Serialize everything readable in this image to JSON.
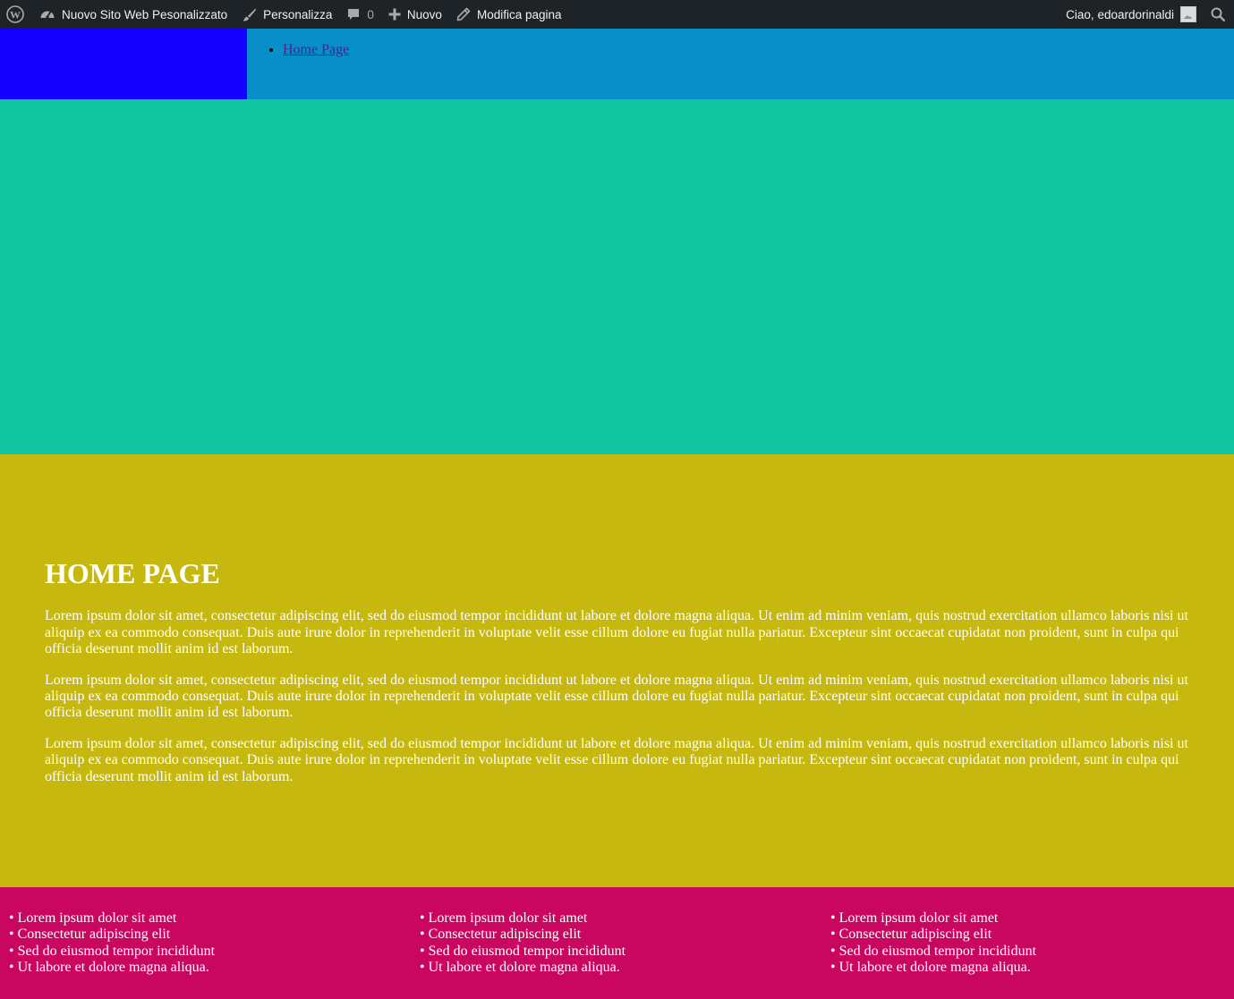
{
  "admin_bar": {
    "wp_logo_icon": "wordpress-logo-icon",
    "site_name": "Nuovo Sito Web Pesonalizzato",
    "customize": "Personalizza",
    "comments_count": "0",
    "new": "Nuovo",
    "edit_page": "Modifica pagina",
    "greeting": "Ciao, edoardorinaldi",
    "search_icon": "search-icon"
  },
  "header": {
    "nav": [
      {
        "label": "Home Page"
      }
    ],
    "colors": {
      "logo_block": "#1500ff",
      "nav_block": "#088ec8"
    }
  },
  "hero": {
    "color": "#0fc6a0"
  },
  "content": {
    "title": "HOME PAGE",
    "paragraphs": [
      "Lorem ipsum dolor sit amet, consectetur adipiscing elit, sed do eiusmod tempor incididunt ut labore et dolore magna aliqua. Ut enim ad minim veniam, quis nostrud exercitation ullamco laboris nisi ut aliquip ex ea commodo consequat. Duis aute irure dolor in reprehenderit in voluptate velit esse cillum dolore eu fugiat nulla pariatur. Excepteur sint occaecat cupidatat non proident, sunt in culpa qui officia deserunt mollit anim id est laborum.",
      "Lorem ipsum dolor sit amet, consectetur adipiscing elit, sed do eiusmod tempor incididunt ut labore et dolore magna aliqua. Ut enim ad minim veniam, quis nostrud exercitation ullamco laboris nisi ut aliquip ex ea commodo consequat. Duis aute irure dolor in reprehenderit in voluptate velit esse cillum dolore eu fugiat nulla pariatur. Excepteur sint occaecat cupidatat non proident, sunt in culpa qui officia deserunt mollit anim id est laborum.",
      "Lorem ipsum dolor sit amet, consectetur adipiscing elit, sed do eiusmod tempor incididunt ut labore et dolore magna aliqua. Ut enim ad minim veniam, quis nostrud exercitation ullamco laboris nisi ut aliquip ex ea commodo consequat. Duis aute irure dolor in reprehenderit in voluptate velit esse cillum dolore eu fugiat nulla pariatur. Excepteur sint occaecat cupidatat non proident, sunt in culpa qui officia deserunt mollit anim id est laborum."
    ],
    "color": "#c6b80e"
  },
  "footer": {
    "color": "#c90760",
    "columns": [
      {
        "items": [
          "Lorem ipsum dolor sit amet",
          "Consectetur adipiscing elit",
          "Sed do eiusmod tempor incididunt",
          "Ut labore et dolore magna aliqua."
        ]
      },
      {
        "items": [
          "Lorem ipsum dolor sit amet",
          "Consectetur adipiscing elit",
          "Sed do eiusmod tempor incididunt",
          "Ut labore et dolore magna aliqua."
        ]
      },
      {
        "items": [
          "Lorem ipsum dolor sit amet",
          "Consectetur adipiscing elit",
          "Sed do eiusmod tempor incididunt",
          "Ut labore et dolore magna aliqua."
        ]
      }
    ]
  }
}
